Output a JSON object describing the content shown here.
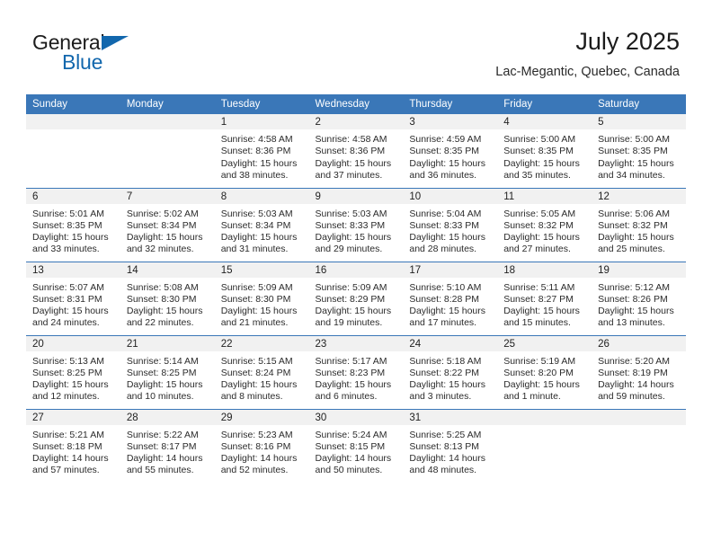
{
  "brand": {
    "word_one": "General",
    "word_two": "Blue",
    "flag_icon": "triangle-flag-icon"
  },
  "header": {
    "title": "July 2025",
    "location": "Lac-Megantic, Quebec, Canada"
  },
  "calendar": {
    "weekday_headers": [
      "Sunday",
      "Monday",
      "Tuesday",
      "Wednesday",
      "Thursday",
      "Friday",
      "Saturday"
    ],
    "colors": {
      "header_blue": "#3a77b8",
      "daynum_band": "#f1f1f1",
      "brand_blue": "#1267ad",
      "text": "#2b2b2b"
    },
    "labels": {
      "sunrise": "Sunrise:",
      "sunset": "Sunset:",
      "daylight": "Daylight:"
    },
    "weeks": [
      [
        {
          "day": "",
          "blank": true
        },
        {
          "day": "",
          "blank": true
        },
        {
          "day": "1",
          "sunrise": "Sunrise: 4:58 AM",
          "sunset": "Sunset: 8:36 PM",
          "daylight": "Daylight: 15 hours and 38 minutes."
        },
        {
          "day": "2",
          "sunrise": "Sunrise: 4:58 AM",
          "sunset": "Sunset: 8:36 PM",
          "daylight": "Daylight: 15 hours and 37 minutes."
        },
        {
          "day": "3",
          "sunrise": "Sunrise: 4:59 AM",
          "sunset": "Sunset: 8:35 PM",
          "daylight": "Daylight: 15 hours and 36 minutes."
        },
        {
          "day": "4",
          "sunrise": "Sunrise: 5:00 AM",
          "sunset": "Sunset: 8:35 PM",
          "daylight": "Daylight: 15 hours and 35 minutes."
        },
        {
          "day": "5",
          "sunrise": "Sunrise: 5:00 AM",
          "sunset": "Sunset: 8:35 PM",
          "daylight": "Daylight: 15 hours and 34 minutes."
        }
      ],
      [
        {
          "day": "6",
          "sunrise": "Sunrise: 5:01 AM",
          "sunset": "Sunset: 8:35 PM",
          "daylight": "Daylight: 15 hours and 33 minutes."
        },
        {
          "day": "7",
          "sunrise": "Sunrise: 5:02 AM",
          "sunset": "Sunset: 8:34 PM",
          "daylight": "Daylight: 15 hours and 32 minutes."
        },
        {
          "day": "8",
          "sunrise": "Sunrise: 5:03 AM",
          "sunset": "Sunset: 8:34 PM",
          "daylight": "Daylight: 15 hours and 31 minutes."
        },
        {
          "day": "9",
          "sunrise": "Sunrise: 5:03 AM",
          "sunset": "Sunset: 8:33 PM",
          "daylight": "Daylight: 15 hours and 29 minutes."
        },
        {
          "day": "10",
          "sunrise": "Sunrise: 5:04 AM",
          "sunset": "Sunset: 8:33 PM",
          "daylight": "Daylight: 15 hours and 28 minutes."
        },
        {
          "day": "11",
          "sunrise": "Sunrise: 5:05 AM",
          "sunset": "Sunset: 8:32 PM",
          "daylight": "Daylight: 15 hours and 27 minutes."
        },
        {
          "day": "12",
          "sunrise": "Sunrise: 5:06 AM",
          "sunset": "Sunset: 8:32 PM",
          "daylight": "Daylight: 15 hours and 25 minutes."
        }
      ],
      [
        {
          "day": "13",
          "sunrise": "Sunrise: 5:07 AM",
          "sunset": "Sunset: 8:31 PM",
          "daylight": "Daylight: 15 hours and 24 minutes."
        },
        {
          "day": "14",
          "sunrise": "Sunrise: 5:08 AM",
          "sunset": "Sunset: 8:30 PM",
          "daylight": "Daylight: 15 hours and 22 minutes."
        },
        {
          "day": "15",
          "sunrise": "Sunrise: 5:09 AM",
          "sunset": "Sunset: 8:30 PM",
          "daylight": "Daylight: 15 hours and 21 minutes."
        },
        {
          "day": "16",
          "sunrise": "Sunrise: 5:09 AM",
          "sunset": "Sunset: 8:29 PM",
          "daylight": "Daylight: 15 hours and 19 minutes."
        },
        {
          "day": "17",
          "sunrise": "Sunrise: 5:10 AM",
          "sunset": "Sunset: 8:28 PM",
          "daylight": "Daylight: 15 hours and 17 minutes."
        },
        {
          "day": "18",
          "sunrise": "Sunrise: 5:11 AM",
          "sunset": "Sunset: 8:27 PM",
          "daylight": "Daylight: 15 hours and 15 minutes."
        },
        {
          "day": "19",
          "sunrise": "Sunrise: 5:12 AM",
          "sunset": "Sunset: 8:26 PM",
          "daylight": "Daylight: 15 hours and 13 minutes."
        }
      ],
      [
        {
          "day": "20",
          "sunrise": "Sunrise: 5:13 AM",
          "sunset": "Sunset: 8:25 PM",
          "daylight": "Daylight: 15 hours and 12 minutes."
        },
        {
          "day": "21",
          "sunrise": "Sunrise: 5:14 AM",
          "sunset": "Sunset: 8:25 PM",
          "daylight": "Daylight: 15 hours and 10 minutes."
        },
        {
          "day": "22",
          "sunrise": "Sunrise: 5:15 AM",
          "sunset": "Sunset: 8:24 PM",
          "daylight": "Daylight: 15 hours and 8 minutes."
        },
        {
          "day": "23",
          "sunrise": "Sunrise: 5:17 AM",
          "sunset": "Sunset: 8:23 PM",
          "daylight": "Daylight: 15 hours and 6 minutes."
        },
        {
          "day": "24",
          "sunrise": "Sunrise: 5:18 AM",
          "sunset": "Sunset: 8:22 PM",
          "daylight": "Daylight: 15 hours and 3 minutes."
        },
        {
          "day": "25",
          "sunrise": "Sunrise: 5:19 AM",
          "sunset": "Sunset: 8:20 PM",
          "daylight": "Daylight: 15 hours and 1 minute."
        },
        {
          "day": "26",
          "sunrise": "Sunrise: 5:20 AM",
          "sunset": "Sunset: 8:19 PM",
          "daylight": "Daylight: 14 hours and 59 minutes."
        }
      ],
      [
        {
          "day": "27",
          "sunrise": "Sunrise: 5:21 AM",
          "sunset": "Sunset: 8:18 PM",
          "daylight": "Daylight: 14 hours and 57 minutes."
        },
        {
          "day": "28",
          "sunrise": "Sunrise: 5:22 AM",
          "sunset": "Sunset: 8:17 PM",
          "daylight": "Daylight: 14 hours and 55 minutes."
        },
        {
          "day": "29",
          "sunrise": "Sunrise: 5:23 AM",
          "sunset": "Sunset: 8:16 PM",
          "daylight": "Daylight: 14 hours and 52 minutes."
        },
        {
          "day": "30",
          "sunrise": "Sunrise: 5:24 AM",
          "sunset": "Sunset: 8:15 PM",
          "daylight": "Daylight: 14 hours and 50 minutes."
        },
        {
          "day": "31",
          "sunrise": "Sunrise: 5:25 AM",
          "sunset": "Sunset: 8:13 PM",
          "daylight": "Daylight: 14 hours and 48 minutes."
        },
        {
          "day": "",
          "blank": true
        },
        {
          "day": "",
          "blank": true
        }
      ]
    ]
  }
}
